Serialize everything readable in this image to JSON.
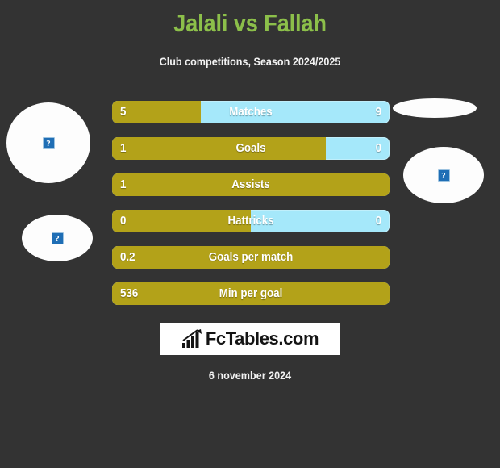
{
  "header": {
    "title": "Jalali vs Fallah",
    "subtitle": "Club competitions, Season 2024/2025",
    "title_color": "#8cbf4a"
  },
  "colors": {
    "background": "#333333",
    "home_bar": "#b3a219",
    "away_bar": "#a5e8fa",
    "text": "#ffffff",
    "placeholder_blue": "#1f6eb5",
    "avatar_fill": "#fdfdfd"
  },
  "avatars": [
    {
      "name": "home-player-photo",
      "placeholder_glyph": "?"
    },
    {
      "name": "home-club-logo",
      "placeholder_glyph": "?"
    },
    {
      "name": "away-club-logo",
      "placeholder_glyph": ""
    },
    {
      "name": "away-player-photo",
      "placeholder_glyph": "?"
    }
  ],
  "chart_data": {
    "type": "bar",
    "title": "Jalali vs Fallah",
    "subtitle": "Club competitions, Season 2024/2025",
    "orientation": "horizontal-diverging",
    "categories": [
      "Matches",
      "Goals",
      "Assists",
      "Hattricks",
      "Goals per match",
      "Min per goal"
    ],
    "series": [
      {
        "name": "Jalali",
        "color": "#b3a219",
        "values": [
          "5",
          "1",
          "1",
          "0",
          "0.2",
          "536"
        ]
      },
      {
        "name": "Fallah",
        "color": "#a5e8fa",
        "values": [
          "9",
          "0",
          "",
          "0",
          "",
          ""
        ]
      }
    ],
    "rows": [
      {
        "label": "Matches",
        "left_value": "5",
        "right_value": "9",
        "left_pct": 32.0,
        "show_right": true
      },
      {
        "label": "Goals",
        "left_value": "1",
        "right_value": "0",
        "left_pct": 77.0,
        "show_right": true
      },
      {
        "label": "Assists",
        "left_value": "1",
        "right_value": "",
        "left_pct": 100.0,
        "show_right": false
      },
      {
        "label": "Hattricks",
        "left_value": "0",
        "right_value": "0",
        "left_pct": 50.0,
        "show_right": true
      },
      {
        "label": "Goals per match",
        "left_value": "0.2",
        "right_value": "",
        "left_pct": 100.0,
        "show_right": false
      },
      {
        "label": "Min per goal",
        "left_value": "536",
        "right_value": "",
        "left_pct": 100.0,
        "show_right": false
      }
    ],
    "legend_position": "none",
    "grid": false
  },
  "logo": {
    "text": "FcTables.com",
    "icon": "bar-chart-icon"
  },
  "footer": {
    "date": "6 november 2024"
  }
}
